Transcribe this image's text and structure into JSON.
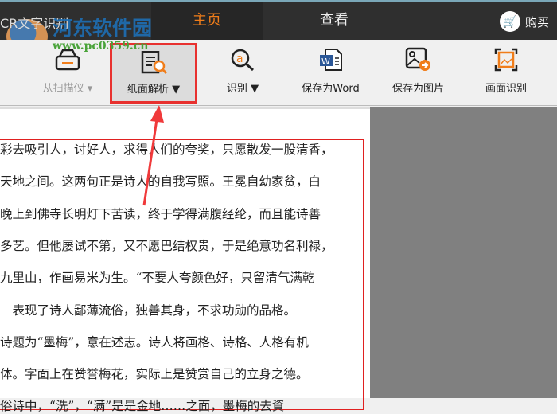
{
  "app": {
    "title": "CR文字识别",
    "tabs": [
      {
        "label": "主页"
      },
      {
        "label": "查看"
      }
    ],
    "buy_label": "购买"
  },
  "watermark": {
    "name": "河东软件园",
    "url": "www.pc0359.cn"
  },
  "toolbar": [
    {
      "label": "从扫描仪",
      "icon": "scanner-icon",
      "dropdown": true,
      "disabled": true
    },
    {
      "label": "纸面解析",
      "icon": "document-search-icon",
      "dropdown": true,
      "selected": true
    },
    {
      "label": "识别",
      "icon": "recognize-icon",
      "dropdown": true
    },
    {
      "label": "保存为Word",
      "icon": "word-icon"
    },
    {
      "label": "保存为图片",
      "icon": "image-export-icon"
    },
    {
      "label": "画面识别",
      "icon": "screen-capture-icon"
    }
  ],
  "colors": {
    "accent": "#f07d1a",
    "highlight": "#e8312f"
  },
  "document": {
    "lines": [
      "彩去吸引人，讨好人，求得人们的夸奖，只愿散发一股清香，",
      "天地之间。这两句正是诗人的自我写照。王冕自幼家贫，白",
      "晚上到佛寺长明灯下苦读，终于学得满腹经纶，而且能诗善",
      "多艺。但他屡试不第，又不愿巴结权贵，于是绝意功名利禄，",
      "九里山，作画易米为生。“不要人夸颜色好，只留清气满乾",
      "　表现了诗人鄙薄流俗，独善其身，不求功勋的品格。",
      "诗题为“墨梅”，意在述志。诗人将画格、诗格、人格有机",
      "体。字面上在赞誉梅花，实际上是赞赏自己的立身之德。",
      "俗诗中，“洗”，“满”是是金地……之面，墨梅的去資"
    ]
  }
}
